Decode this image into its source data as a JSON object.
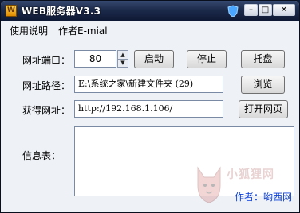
{
  "window": {
    "title": "WEB服务器V3.3"
  },
  "menu": {
    "items": [
      "使用说明",
      "作者E-mial"
    ]
  },
  "form": {
    "port_label": "网址端口：",
    "port_value": "80",
    "start_button": "启动",
    "stop_button": "停止",
    "tray_button": "托盘",
    "path_label": "网址路径：",
    "path_value": "E:\\系统之家\\新建文件夹 (29)",
    "browse_button": "浏览",
    "url_label": "获得网址：",
    "url_value": "http://192.168.1.106/",
    "open_button": "打开网页",
    "info_label": "信息表：",
    "info_value": ""
  },
  "author": "作者：哟西网",
  "watermark": {
    "text": "小狐狸网"
  }
}
